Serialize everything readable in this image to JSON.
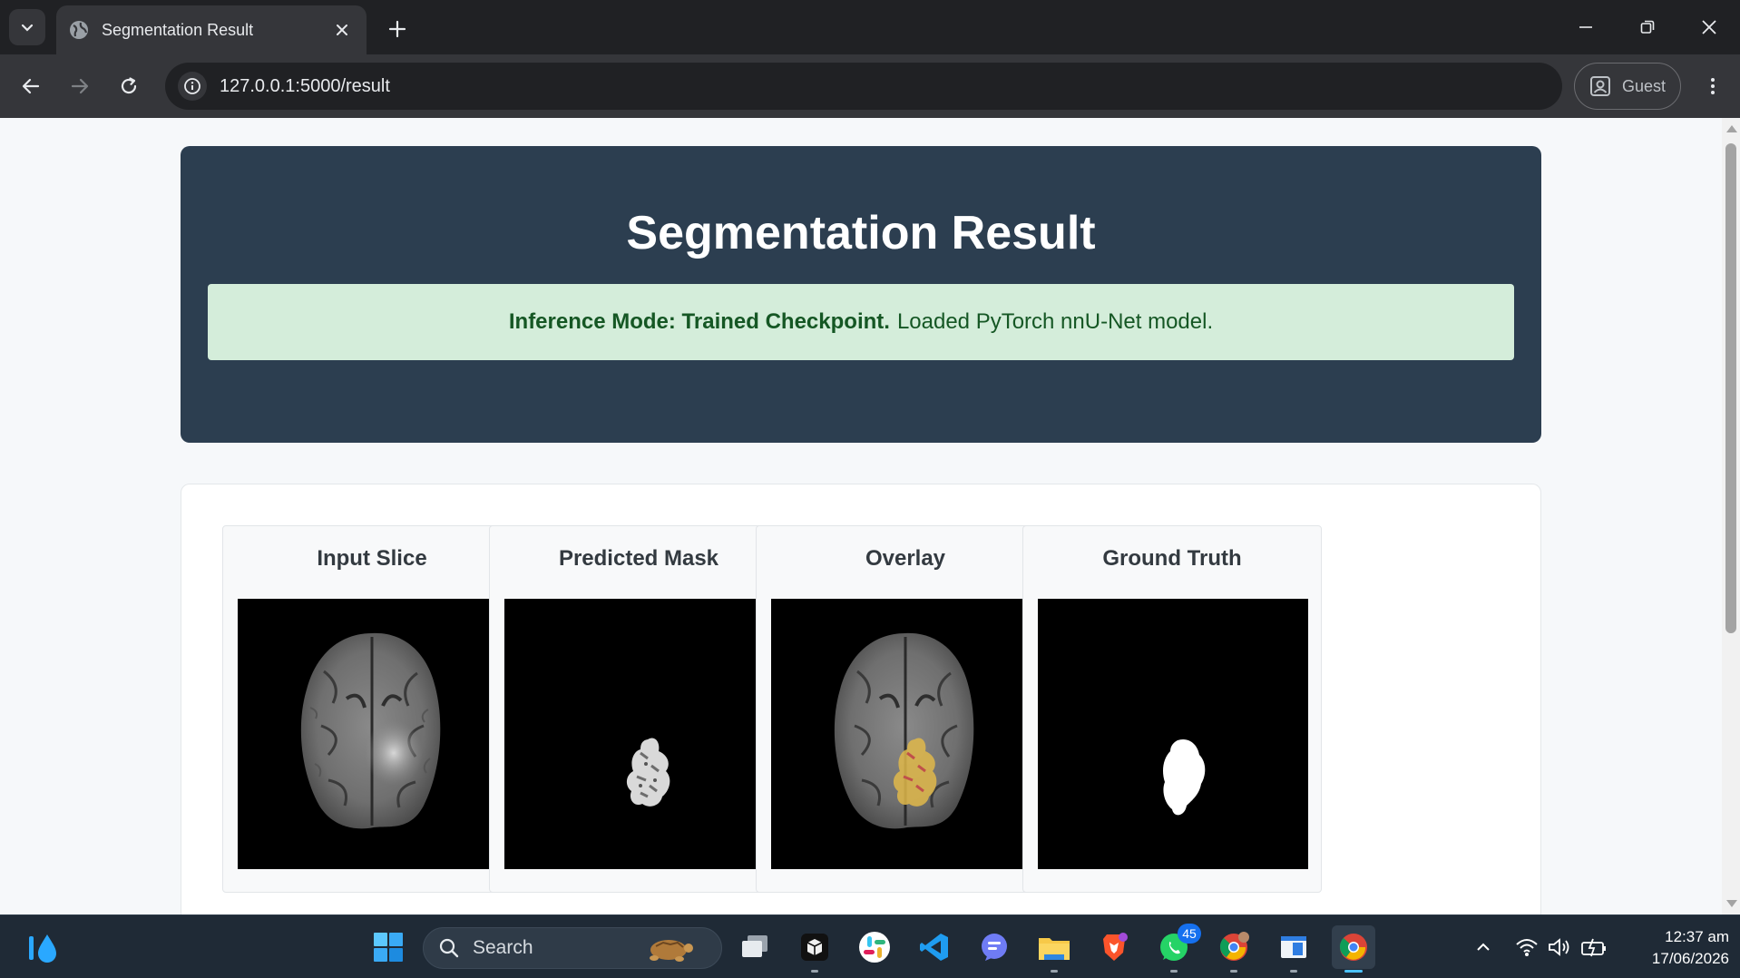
{
  "browser": {
    "tab_title": "Segmentation Result",
    "url": "127.0.0.1:5000/result",
    "profile_label": "Guest"
  },
  "page": {
    "title": "Segmentation Result",
    "alert": {
      "bold": "Inference Mode: Trained Checkpoint.",
      "text": "Loaded PyTorch nnU-Net model."
    },
    "panels": [
      {
        "title": "Input Slice"
      },
      {
        "title": "Predicted Mask"
      },
      {
        "title": "Overlay"
      },
      {
        "title": "Ground Truth"
      }
    ]
  },
  "taskbar": {
    "search_label": "Search",
    "whatsapp_badge": "45",
    "clock_time": "12:37 am",
    "clock_date": "17/06/2026",
    "icons": [
      "water-drop-icon",
      "windows-start-icon",
      "task-view-icon",
      "box-app-icon",
      "slack-icon",
      "vscode-icon",
      "chat-app-icon",
      "file-explorer-icon",
      "brave-icon",
      "whatsapp-icon",
      "chrome-profile-icon",
      "notepad-icon",
      "chrome-icon"
    ]
  },
  "colors": {
    "header_bg": "#2c3e50",
    "alert_bg": "#d4edda",
    "alert_text": "#155724",
    "browser_dark": "#202124",
    "taskbar_bg": "#1f2a36"
  }
}
